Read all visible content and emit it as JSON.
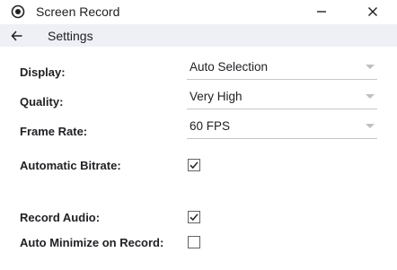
{
  "window": {
    "title": "Screen Record",
    "icon": "record-icon"
  },
  "nav": {
    "title": "Settings",
    "back_icon": "arrow-left-icon"
  },
  "settings": {
    "display": {
      "label": "Display:",
      "value": "Auto Selection"
    },
    "quality": {
      "label": "Quality:",
      "value": "Very High"
    },
    "frame_rate": {
      "label": "Frame Rate:",
      "value": "60 FPS"
    },
    "automatic_bitrate": {
      "label": "Automatic Bitrate:",
      "checked": true
    },
    "record_audio": {
      "label": "Record Audio:",
      "checked": true
    },
    "auto_minimize": {
      "label": "Auto Minimize on Record:",
      "checked": false
    }
  },
  "colors": {
    "navbar_bg": "#eef0f6",
    "text": "#202124",
    "underline": "#c8c8c8"
  }
}
